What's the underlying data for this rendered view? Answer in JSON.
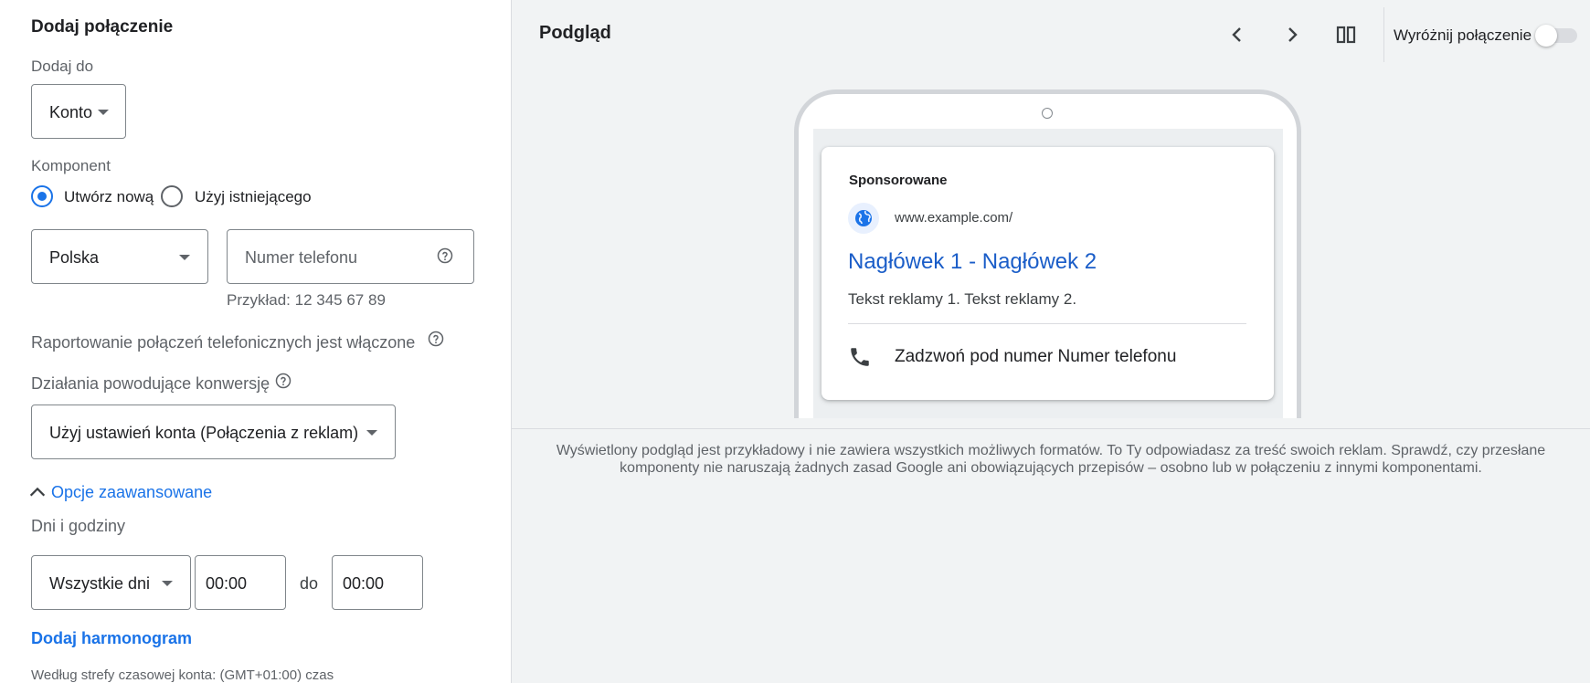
{
  "left": {
    "title": "Dodaj połączenie",
    "add_to_label": "Dodaj do",
    "add_to_value": "Konto",
    "component_label": "Komponent",
    "radio_new": "Utwórz nową",
    "radio_existing": "Użyj istniejącego",
    "country_value": "Polska",
    "phone_placeholder": "Numer telefonu",
    "phone_example": "Przykład: 12 345 67 89",
    "reporting_text": "Raportowanie połączeń telefonicznych jest włączone",
    "conversion_label": "Działania powodujące konwersję",
    "conversion_value": "Użyj ustawień konta (Połączenia z reklam)",
    "advanced_link": "Opcje zaawansowane",
    "days_hours_label": "Dni i godziny",
    "days_value": "Wszystkie dni",
    "time_from": "00:00",
    "to_label": "do",
    "time_to": "00:00",
    "add_schedule_link": "Dodaj harmonogram",
    "timezone_text": "Według strefy czasowej konta: (GMT+01:00) czas"
  },
  "preview": {
    "title": "Podgląd",
    "highlight_label": "Wyróżnij połączenie",
    "highlight_on": false,
    "ad": {
      "sponsored": "Sponsorowane",
      "url": "www.example.com/",
      "headline": "Nagłówek 1 - Nagłówek 2",
      "description": "Tekst reklamy 1. Tekst reklamy 2.",
      "call_text": "Zadzwoń pod numer Numer telefonu"
    },
    "disclaimer_line1": "Wyświetlony podgląd jest przykładowy i nie zawiera wszystkich możliwych formatów. To Ty odpowiadasz za treść swoich reklam. Sprawdź, czy przesłane",
    "disclaimer_line2": "komponenty nie naruszają żadnych zasad Google ani obowiązujących przepisów – osobno lub w połączeniu z innymi komponentami."
  },
  "icons": {
    "prev": "chevron-left-icon",
    "next": "chevron-right-icon",
    "layout": "columns-icon",
    "help": "help-circle-icon",
    "globe": "globe-icon",
    "phone": "phone-icon",
    "expand": "chevron-up-icon"
  },
  "colors": {
    "accent": "#1a73e8",
    "headline": "#1a0dab",
    "background": "#f1f3f4"
  }
}
